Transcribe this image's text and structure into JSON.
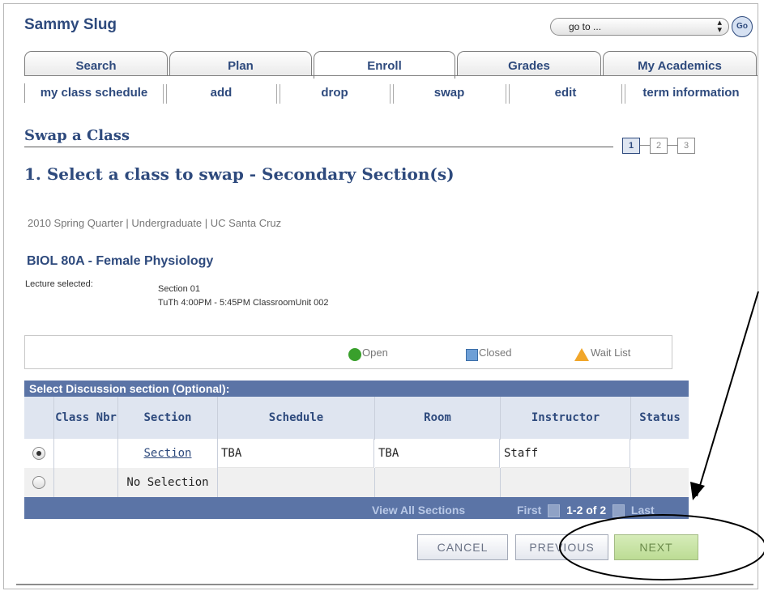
{
  "app": {
    "title": "Sammy Slug"
  },
  "header": {
    "goto_value": "go to ...",
    "go_label": "Go"
  },
  "tabs": [
    {
      "label": "Search"
    },
    {
      "label": "Plan"
    },
    {
      "label": "Enroll"
    },
    {
      "label": "Grades"
    },
    {
      "label": "My Academics"
    }
  ],
  "subtabs": [
    {
      "label": "my class schedule"
    },
    {
      "label": "add"
    },
    {
      "label": "drop"
    },
    {
      "label": "swap"
    },
    {
      "label": "edit"
    },
    {
      "label": "term information"
    }
  ],
  "page": {
    "title": "Swap a Class",
    "steps": [
      "1",
      "2",
      "3"
    ],
    "subtitle": "1.  Select a class to swap - Secondary Section(s)",
    "term": "2010 Spring Quarter | Undergraduate | UC Santa Cruz"
  },
  "course": {
    "title": "BIOL  80A - Female Physiology",
    "lecture_label": "Lecture selected:",
    "lecture_section": "Section 01",
    "lecture_time": "TuTh 4:00PM - 5:45PM   ClassroomUnit 002"
  },
  "legend": {
    "open": "Open",
    "closed": "Closed",
    "wait_list": "Wait List"
  },
  "grid": {
    "title": "Select Discussion section (Optional):",
    "columns": {
      "class_nbr": "Class Nbr",
      "section": "Section",
      "schedule": "Schedule",
      "room": "Room",
      "instructor": "Instructor",
      "status": "Status"
    },
    "rows": [
      {
        "selected": true,
        "class_nbr": "",
        "section": "Section",
        "schedule": "TBA",
        "room": "TBA",
        "instructor": "Staff",
        "status": ""
      },
      {
        "selected": false,
        "class_nbr": "",
        "section": "No Selection",
        "schedule": "",
        "room": "",
        "instructor": "",
        "status": ""
      }
    ],
    "footer": {
      "view_all": "View All Sections",
      "first": "First",
      "range": "1-2 of 2",
      "last": "Last"
    }
  },
  "buttons": {
    "cancel": "CANCEL",
    "previous": "PREVIOUS",
    "next": "NEXT"
  },
  "colors": {
    "brand": "#2e4a7d",
    "grid_header": "#5b74a6",
    "next_button": "#c8e3a6",
    "open": "#39a02c",
    "closed": "#6e9fd6",
    "wait_list": "#f1a62a"
  }
}
